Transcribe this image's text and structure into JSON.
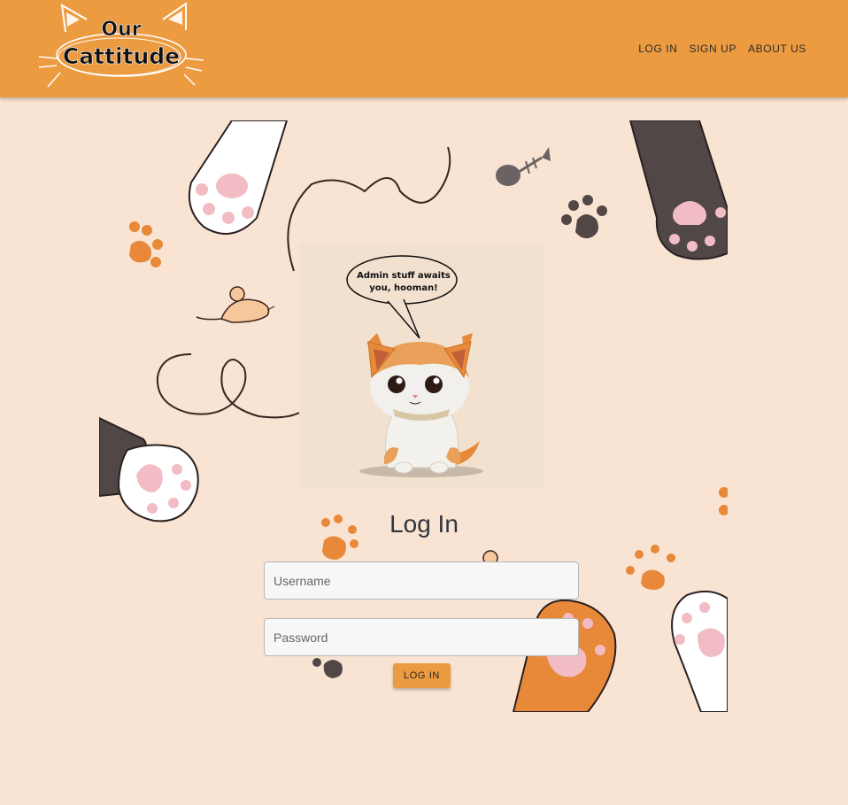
{
  "header": {
    "logo_line1": "Our",
    "logo_line2": "Cattitude",
    "nav": [
      {
        "label": "LOG IN"
      },
      {
        "label": "SIGN UP"
      },
      {
        "label": "ABOUT US"
      }
    ]
  },
  "hero": {
    "speech_line1": "Admin stuff awaits",
    "speech_line2": "you, hooman!"
  },
  "form": {
    "title": "Log In",
    "username_placeholder": "Username",
    "password_placeholder": "Password",
    "submit_label": "LOG IN"
  },
  "colors": {
    "header": "#ed9b40",
    "page_background": "#f9e3d2",
    "paw_orange": "#e8893a",
    "paw_dark": "#524747",
    "paw_pink": "#f2bcc4"
  },
  "icons": [
    "cat-ears-logo",
    "paw-print-icon",
    "fish-bone-icon",
    "toy-mouse-icon",
    "cat-paw-icon",
    "kitten-illustration"
  ]
}
